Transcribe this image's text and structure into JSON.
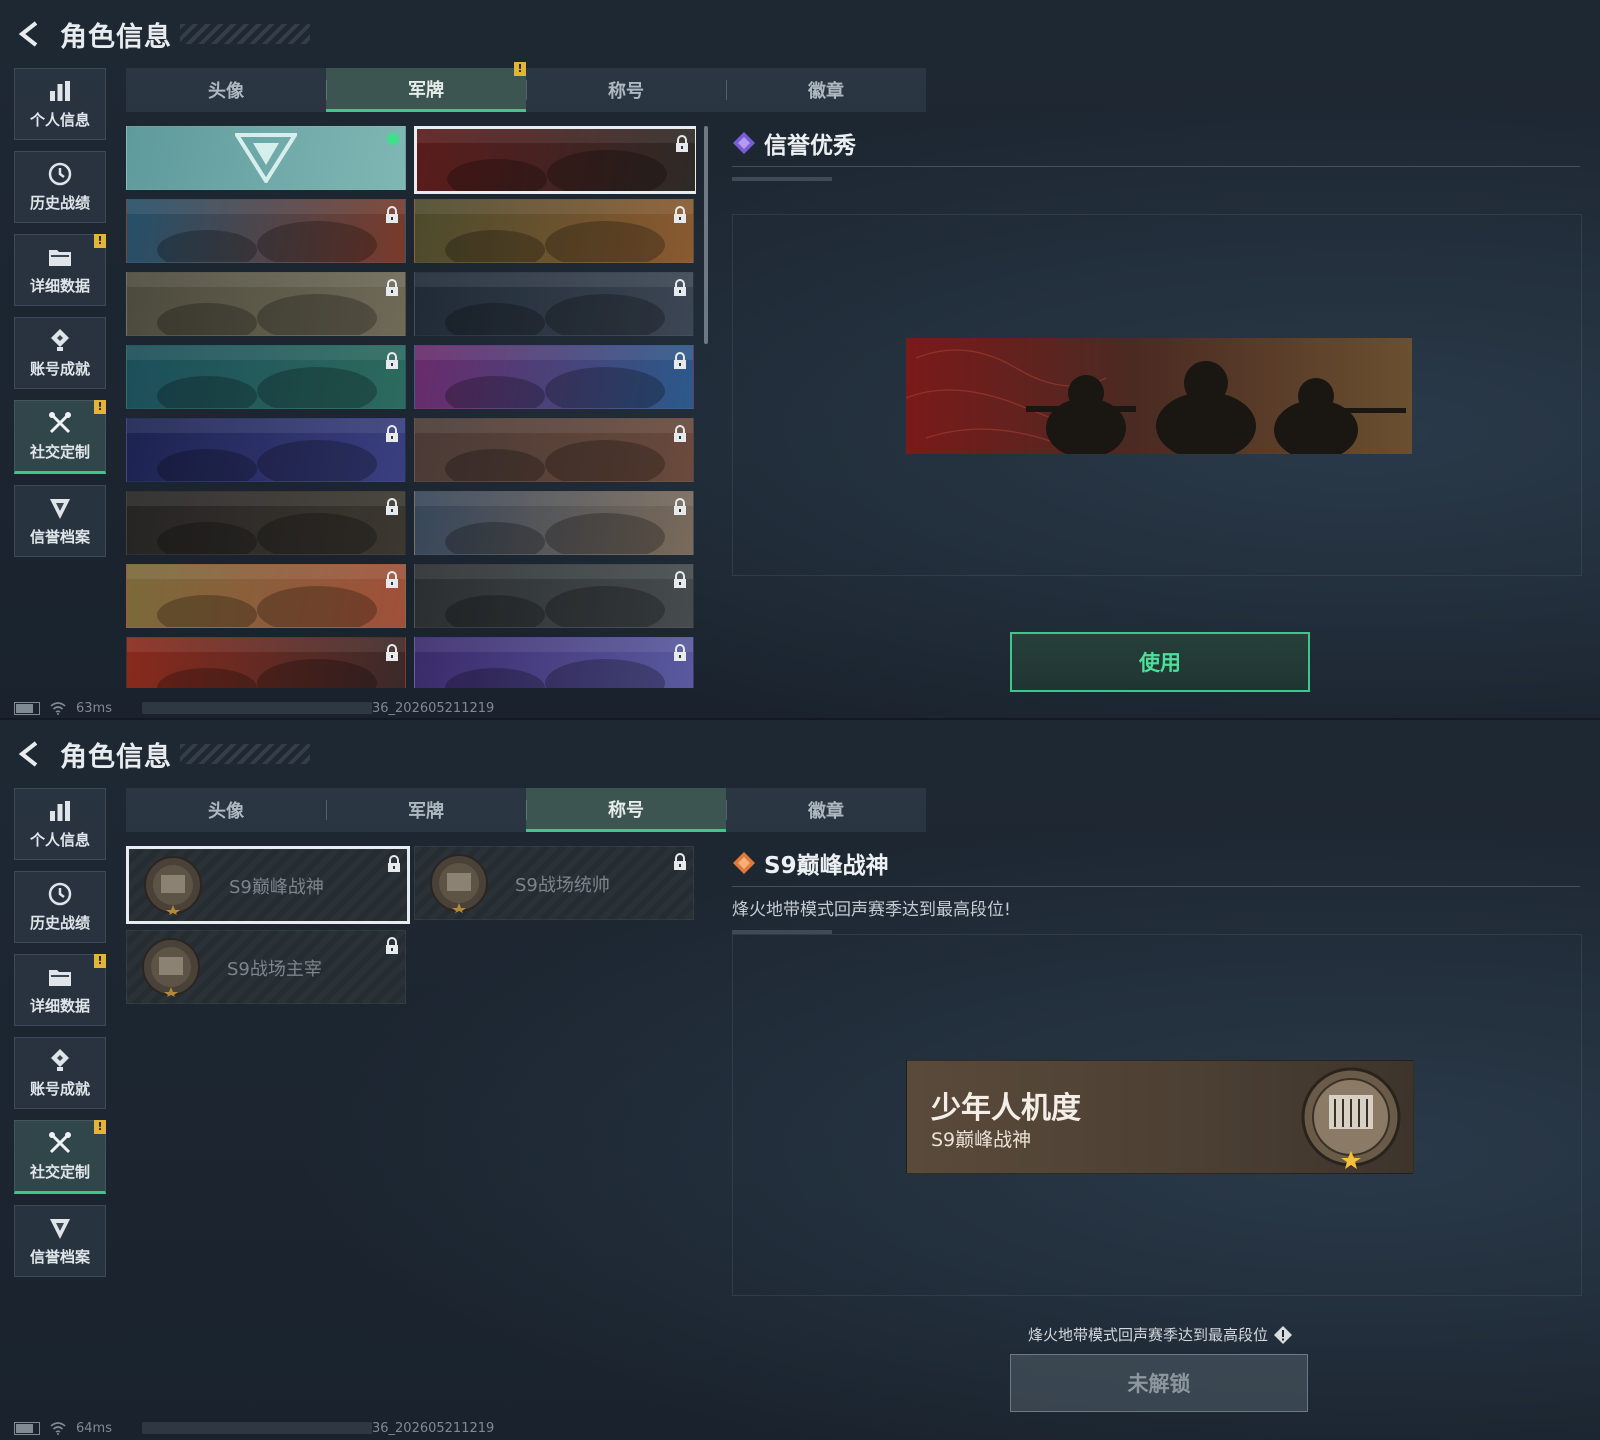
{
  "common": {
    "header_title": "角色信息",
    "sidebar": [
      {
        "label": "个人信息",
        "icon": "bar-chart-icon",
        "notif": false,
        "active": false
      },
      {
        "label": "历史战绩",
        "icon": "clock-icon",
        "notif": false,
        "active": false
      },
      {
        "label": "详细数据",
        "icon": "folder-icon",
        "notif": true,
        "active": false
      },
      {
        "label": "账号成就",
        "icon": "achievement-icon",
        "notif": false,
        "active": false
      },
      {
        "label": "社交定制",
        "icon": "tools-icon",
        "notif": true,
        "active": true
      },
      {
        "label": "信誉档案",
        "icon": "shield-icon",
        "notif": false,
        "active": false
      }
    ],
    "tabs": [
      "头像",
      "军牌",
      "称号",
      "徽章"
    ],
    "notif_mark": "!",
    "build_id": "36_202605211219"
  },
  "panel1": {
    "active_tab": 1,
    "ping": "63ms",
    "selected_name": "信誉优秀",
    "use_button": "使用",
    "accent": "#3ec78a",
    "cards": [
      {
        "state": "equipped",
        "colors": [
          "#5f9a9c",
          "#7fb7b4"
        ]
      },
      {
        "state": "selected-locked",
        "colors": [
          "#5a1c1c",
          "#2d2a26"
        ]
      },
      {
        "state": "locked",
        "colors": [
          "#24506a",
          "#7a3a2a"
        ]
      },
      {
        "state": "locked",
        "colors": [
          "#4b4a2c",
          "#8a5a30"
        ]
      },
      {
        "state": "locked",
        "colors": [
          "#4c4a3c",
          "#6f6a58"
        ]
      },
      {
        "state": "locked",
        "colors": [
          "#1f2a36",
          "#3c4654"
        ]
      },
      {
        "state": "locked",
        "colors": [
          "#1c4e5a",
          "#2c6a5e"
        ]
      },
      {
        "state": "locked",
        "colors": [
          "#6a2a6a",
          "#2a5a8a"
        ]
      },
      {
        "state": "locked",
        "colors": [
          "#1c2350",
          "#3a3f80"
        ]
      },
      {
        "state": "locked",
        "colors": [
          "#4a3a36",
          "#6a4a3c"
        ]
      },
      {
        "state": "locked",
        "colors": [
          "#262424",
          "#3c3830"
        ]
      },
      {
        "state": "locked",
        "colors": [
          "#36465a",
          "#7a6a5a"
        ]
      },
      {
        "state": "locked",
        "colors": [
          "#7a6a3a",
          "#a0503a"
        ]
      },
      {
        "state": "locked",
        "colors": [
          "#2a2e30",
          "#464c4e"
        ]
      },
      {
        "state": "locked",
        "colors": [
          "#8a2a1c",
          "#3a2a2a"
        ]
      },
      {
        "state": "locked",
        "colors": [
          "#3a2a6a",
          "#5a5aa0"
        ]
      }
    ]
  },
  "panel2": {
    "active_tab": 2,
    "ping": "64ms",
    "selected_name": "S9巅峰战神",
    "selected_desc": "烽火地带模式回声赛季达到最高段位!",
    "preview_player": "少年人机度",
    "preview_title": "S9巅峰战神",
    "unlock_hint": "烽火地带模式回声赛季达到最高段位",
    "locked_button": "未解锁",
    "titles": [
      {
        "name": "S9巅峰战神",
        "selected": true
      },
      {
        "name": "S9战场统帅",
        "selected": false
      },
      {
        "name": "S9战场主宰",
        "selected": false
      }
    ]
  }
}
